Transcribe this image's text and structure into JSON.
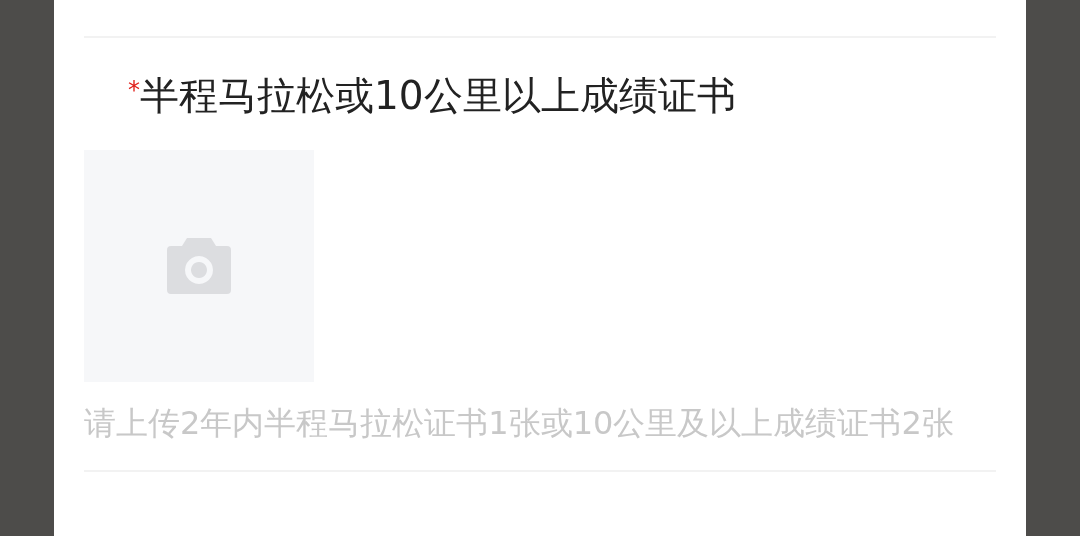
{
  "field": {
    "label": "半程马拉松或10公里以上成绩证书",
    "required": true,
    "required_mark": "*",
    "hint": "请上传2年内半程马拉松证书1张或10公里及以上成绩证书2张"
  }
}
